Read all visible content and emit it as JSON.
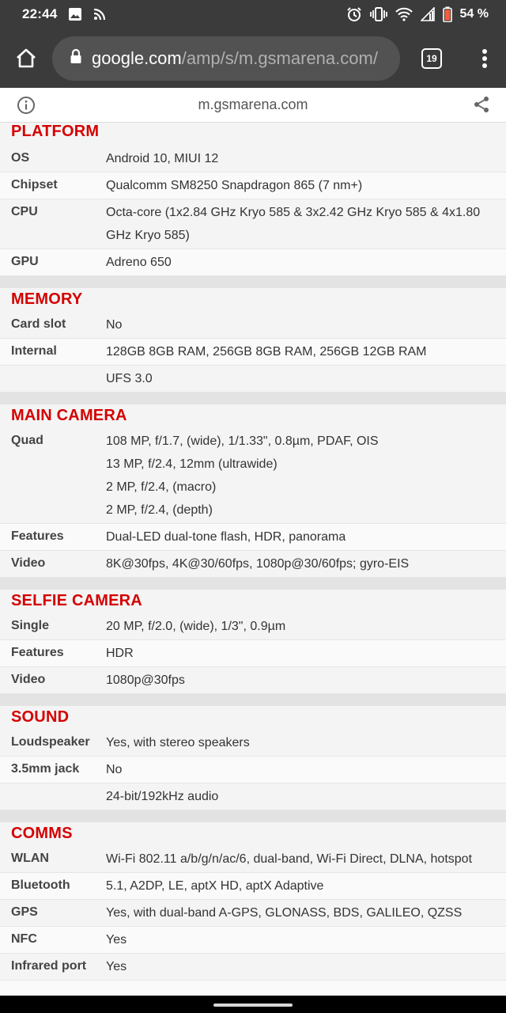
{
  "status_bar": {
    "time": "22:44",
    "battery": "54 %",
    "icons": [
      "image-icon",
      "cast-icon",
      "alarm-icon",
      "vibrate-icon",
      "wifi-icon",
      "signal-icon",
      "battery-icon"
    ]
  },
  "browser": {
    "url_host": "google.com",
    "url_path": "/amp/s/m.gsmarena.com/",
    "tab_count": "19"
  },
  "amp_header": {
    "domain": "m.gsmarena.com"
  },
  "sections": [
    {
      "title": "PLATFORM",
      "rows": [
        {
          "label": "OS",
          "values": [
            "Android 10, MIUI 12"
          ]
        },
        {
          "label": "Chipset",
          "values": [
            "Qualcomm SM8250 Snapdragon 865 (7 nm+)"
          ]
        },
        {
          "label": "CPU",
          "values": [
            "Octa-core (1x2.84 GHz Kryo 585 & 3x2.42 GHz Kryo 585 & 4x1.80 GHz Kryo 585)"
          ]
        },
        {
          "label": "GPU",
          "values": [
            "Adreno 650"
          ]
        }
      ]
    },
    {
      "title": "MEMORY",
      "rows": [
        {
          "label": "Card slot",
          "values": [
            "No"
          ]
        },
        {
          "label": "Internal",
          "values": [
            "128GB 8GB RAM, 256GB 8GB RAM, 256GB 12GB RAM"
          ]
        },
        {
          "label": "",
          "values": [
            "UFS 3.0"
          ]
        }
      ]
    },
    {
      "title": "MAIN CAMERA",
      "rows": [
        {
          "label": "Quad",
          "values": [
            "108 MP, f/1.7, (wide), 1/1.33\", 0.8µm, PDAF, OIS",
            "13 MP, f/2.4, 12mm (ultrawide)",
            "2 MP, f/2.4, (macro)",
            "2 MP, f/2.4, (depth)"
          ]
        },
        {
          "label": "Features",
          "values": [
            "Dual-LED dual-tone flash, HDR, panorama"
          ]
        },
        {
          "label": "Video",
          "values": [
            "8K@30fps, 4K@30/60fps, 1080p@30/60fps; gyro-EIS"
          ]
        }
      ]
    },
    {
      "title": "SELFIE CAMERA",
      "rows": [
        {
          "label": "Single",
          "values": [
            "20 MP, f/2.0, (wide), 1/3\", 0.9µm"
          ]
        },
        {
          "label": "Features",
          "values": [
            "HDR"
          ]
        },
        {
          "label": "Video",
          "values": [
            "1080p@30fps"
          ]
        }
      ]
    },
    {
      "title": "SOUND",
      "rows": [
        {
          "label": "Loudspeaker",
          "values": [
            "Yes, with stereo speakers"
          ]
        },
        {
          "label": "3.5mm jack",
          "values": [
            "No"
          ]
        },
        {
          "label": "",
          "values": [
            "24-bit/192kHz audio"
          ]
        }
      ]
    },
    {
      "title": "COMMS",
      "rows": [
        {
          "label": "WLAN",
          "values": [
            "Wi-Fi 802.11 a/b/g/n/ac/6, dual-band, Wi-Fi Direct, DLNA, hotspot"
          ]
        },
        {
          "label": "Bluetooth",
          "values": [
            "5.1, A2DP, LE, aptX HD, aptX Adaptive"
          ]
        },
        {
          "label": "GPS",
          "values": [
            "Yes, with dual-band A-GPS, GLONASS, BDS, GALILEO, QZSS"
          ]
        },
        {
          "label": "NFC",
          "values": [
            "Yes"
          ]
        },
        {
          "label": "Infrared port",
          "values": [
            "Yes"
          ]
        }
      ]
    }
  ]
}
